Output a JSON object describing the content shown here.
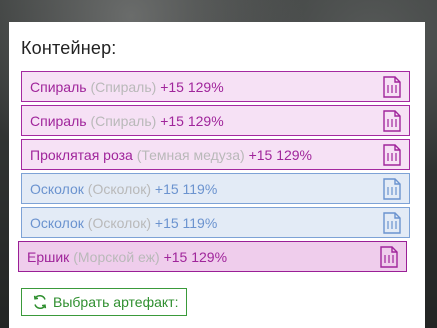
{
  "container": {
    "title": "Контейнер:",
    "items": [
      {
        "name": "Спираль",
        "original": "(Спираль)",
        "bonus": "+15 129%",
        "style": "magenta"
      },
      {
        "name": "Спираль",
        "original": "(Спираль)",
        "bonus": "+15 129%",
        "style": "magenta"
      },
      {
        "name": "Проклятая роза",
        "original": "(Темная медуза)",
        "bonus": "+15 129%",
        "style": "magenta"
      },
      {
        "name": "Осколок",
        "original": "(Осколок)",
        "bonus": "+15 119%",
        "style": "blue"
      },
      {
        "name": "Осколок",
        "original": "(Осколок)",
        "bonus": "+15 119%",
        "style": "blue"
      },
      {
        "name": "Ершик",
        "original": "(Морской еж)",
        "bonus": "+15 129%",
        "style": "magenta-strong"
      }
    ],
    "select_button_label": "Выбрать артефакт:",
    "icons": {
      "item": "document-icon",
      "button": "refresh-icon"
    },
    "colors": {
      "magenta": "#a0259b",
      "blue": "#6b93cf",
      "green": "#2f8f2f"
    }
  }
}
